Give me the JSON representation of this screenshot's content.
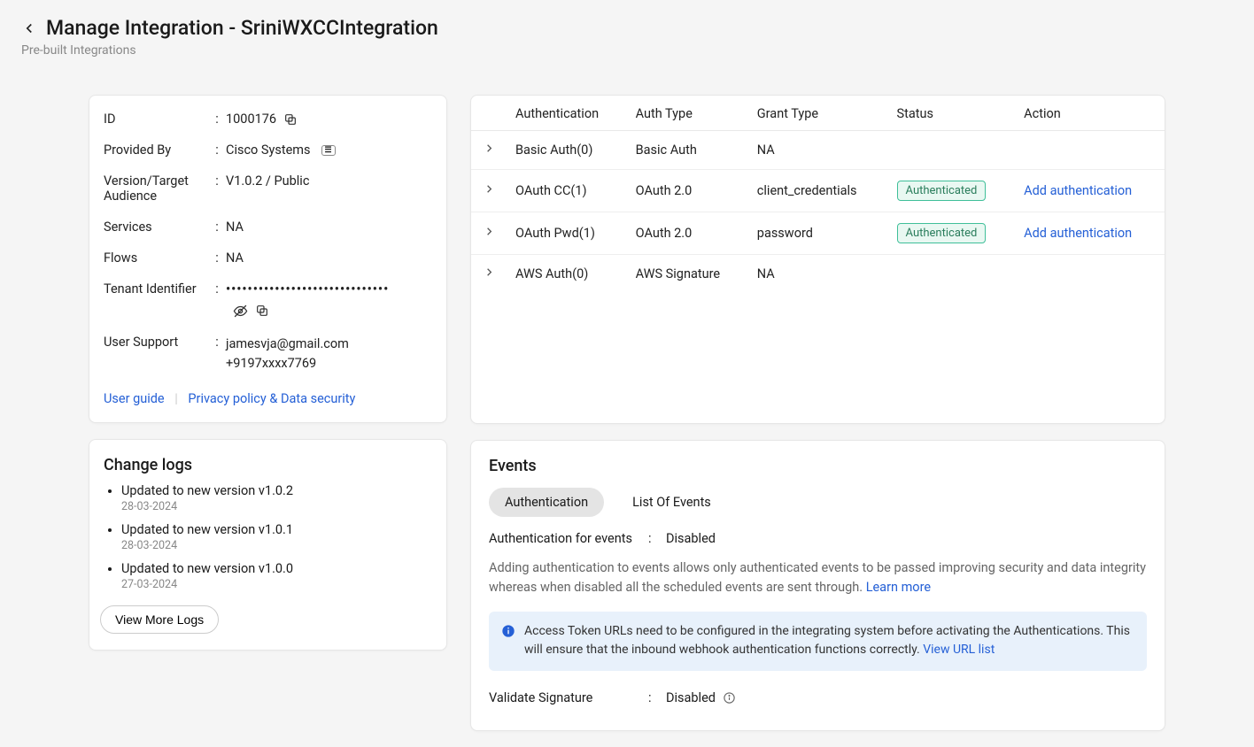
{
  "header": {
    "title": "Manage Integration - SriniWXCCIntegration",
    "subtitle": "Pre-built Integrations"
  },
  "info": {
    "id_label": "ID",
    "id_value": "1000176",
    "provided_by_label": "Provided By",
    "provided_by_value": "Cisco Systems",
    "version_label": "Version/Target Audience",
    "version_value": "V1.0.2 / Public",
    "services_label": "Services",
    "services_value": "NA",
    "flows_label": "Flows",
    "flows_value": "NA",
    "tenant_label": "Tenant Identifier",
    "tenant_masked": "••••••••••••••••••••••••••••••",
    "support_label": "User Support",
    "support_email": "jamesvja@gmail.com",
    "support_phone": "+9197xxxx7769",
    "user_guide": "User guide",
    "privacy": "Privacy policy & Data security"
  },
  "changelog": {
    "title": "Change logs",
    "items": [
      {
        "text": "Updated to new version v1.0.2",
        "date": "28-03-2024"
      },
      {
        "text": "Updated to new version v1.0.1",
        "date": "28-03-2024"
      },
      {
        "text": "Updated to new version v1.0.0",
        "date": "27-03-2024"
      }
    ],
    "view_more": "View More Logs"
  },
  "auth_table": {
    "headers": {
      "authentication": "Authentication",
      "auth_type": "Auth Type",
      "grant_type": "Grant Type",
      "status": "Status",
      "action": "Action"
    },
    "rows": [
      {
        "name": "Basic Auth(0)",
        "type": "Basic Auth",
        "grant": "NA",
        "status": "",
        "action": ""
      },
      {
        "name": "OAuth CC(1)",
        "type": "OAuth 2.0",
        "grant": "client_credentials",
        "status": "Authenticated",
        "action": "Add authentication"
      },
      {
        "name": "OAuth Pwd(1)",
        "type": "OAuth 2.0",
        "grant": "password",
        "status": "Authenticated",
        "action": "Add authentication"
      },
      {
        "name": "AWS Auth(0)",
        "type": "AWS Signature",
        "grant": "NA",
        "status": "",
        "action": ""
      }
    ]
  },
  "events": {
    "title": "Events",
    "tab_auth": "Authentication",
    "tab_list": "List Of Events",
    "auth_for_events_label": "Authentication for events",
    "auth_for_events_value": "Disabled",
    "desc": "Adding authentication to events allows only authenticated events to be passed improving security and data integrity whereas when disabled all the scheduled events are sent through. ",
    "learn_more": "Learn more",
    "alert_text": "Access Token URLs need to be configured in the integrating system before activating the Authentications. This will ensure that the inbound webhook authentication functions correctly. ",
    "alert_link": "View URL list",
    "validate_label": "Validate Signature",
    "validate_value": "Disabled"
  }
}
